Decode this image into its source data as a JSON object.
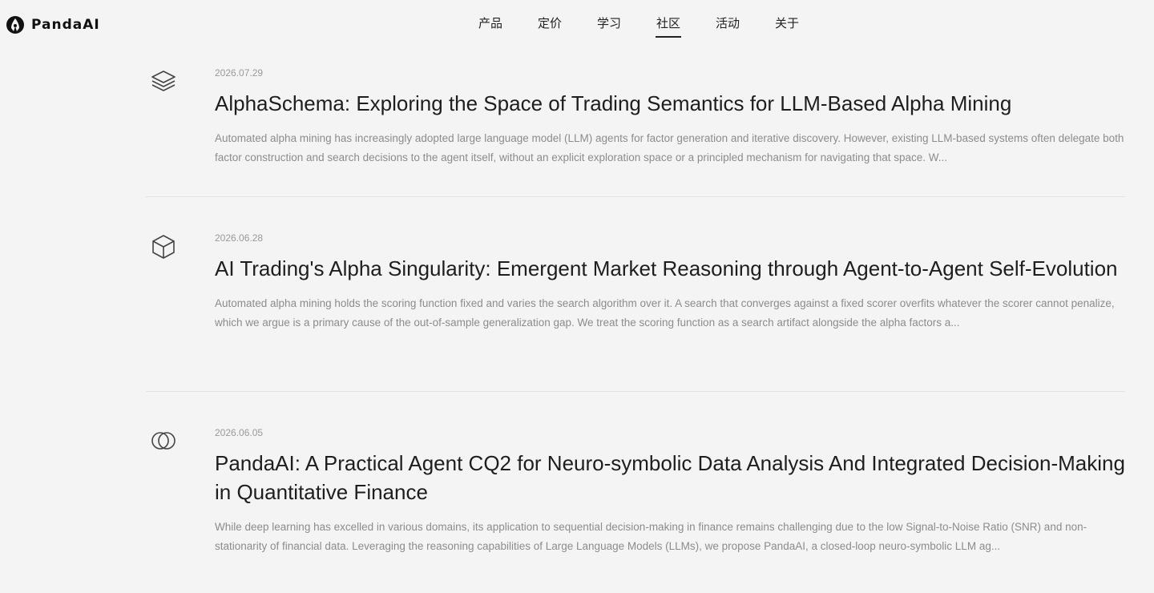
{
  "header": {
    "logo_text": "PandaAI",
    "nav": [
      {
        "label": "产品",
        "active": false
      },
      {
        "label": "定价",
        "active": false
      },
      {
        "label": "学习",
        "active": false
      },
      {
        "label": "社区",
        "active": true
      },
      {
        "label": "活动",
        "active": false
      },
      {
        "label": "关于",
        "active": false
      }
    ]
  },
  "articles": [
    {
      "icon": "layers-icon",
      "date": "2026.07.29",
      "title": "AlphaSchema: Exploring the Space of Trading Semantics for LLM-Based Alpha Mining",
      "abstract": "Automated alpha mining has increasingly adopted large language model (LLM) agents for factor generation and iterative discovery. However, existing LLM-based systems often delegate both factor construction and search decisions to the agent itself, without an explicit exploration space or a principled mechanism for navigating that space. W..."
    },
    {
      "icon": "cube-icon",
      "date": "2026.06.28",
      "title": "AI Trading's Alpha Singularity: Emergent Market Reasoning through Agent-to-Agent Self-Evolution",
      "abstract": "Automated alpha mining holds the scoring function fixed and varies the search algorithm over it. A search that converges against a fixed scorer overfits whatever the scorer cannot penalize, which we argue is a primary cause of the out-of-sample generalization gap. We treat the scoring function as a search artifact alongside the alpha factors a..."
    },
    {
      "icon": "overlapping-circles-icon",
      "date": "2026.06.05",
      "title": "PandaAI: A Practical Agent CQ2 for Neuro-symbolic Data Analysis And Integrated Decision-Making in Quantitative Finance",
      "abstract": "While deep learning has excelled in various domains, its application to sequential decision-making in finance remains challenging due to the low Signal-to-Noise Ratio (SNR) and non-stationarity of financial data. Leveraging the reasoning capabilities of Large Language Models (LLMs), we propose PandaAI, a closed-loop neuro-symbolic LLM ag..."
    }
  ]
}
